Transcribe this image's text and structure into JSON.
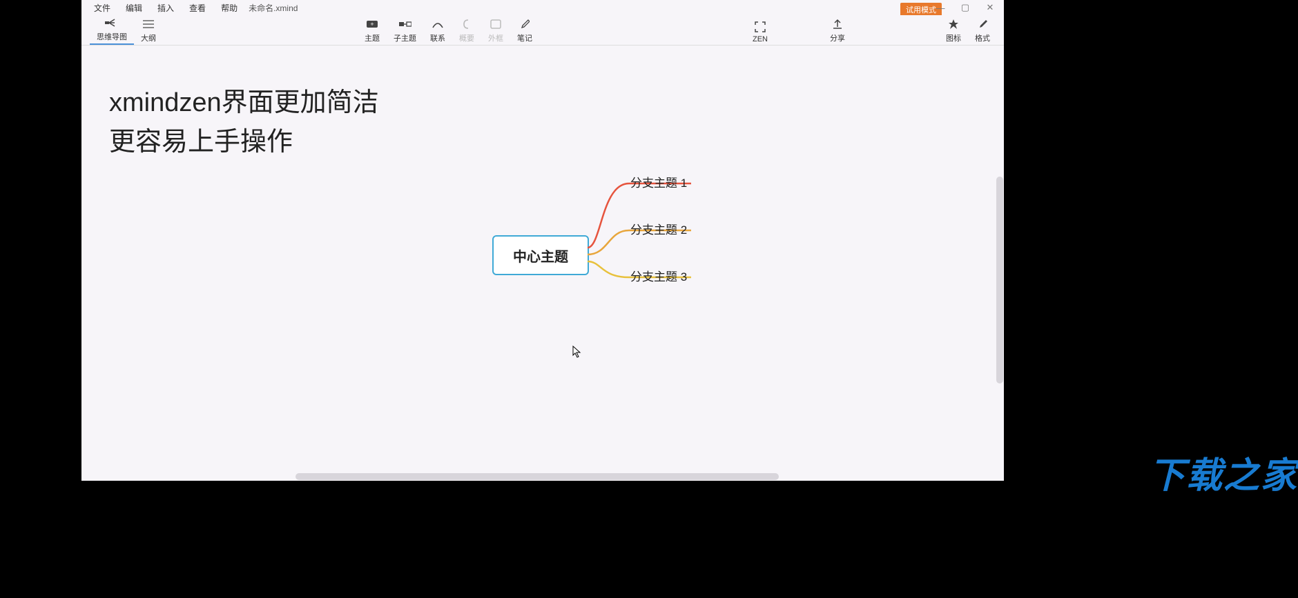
{
  "menubar": {
    "items": [
      "文件",
      "编辑",
      "插入",
      "查看",
      "帮助"
    ],
    "docname": "未命名.xmind"
  },
  "trial_label": "试用模式",
  "window_controls": {
    "min": "—",
    "max": "▢",
    "close": "✕"
  },
  "toolbar": {
    "left": [
      {
        "label": "思维导图",
        "active": true
      },
      {
        "label": "大纲",
        "active": false
      }
    ],
    "center": [
      {
        "label": "主题",
        "disabled": false
      },
      {
        "label": "子主题",
        "disabled": false
      },
      {
        "label": "联系",
        "disabled": false
      },
      {
        "label": "概要",
        "disabled": true
      },
      {
        "label": "外框",
        "disabled": true
      },
      {
        "label": "笔记",
        "disabled": false
      }
    ],
    "zen": "ZEN",
    "share": "分享",
    "right": [
      {
        "label": "图标"
      },
      {
        "label": "格式"
      }
    ]
  },
  "overlay": {
    "line1": "xmindzen界面更加简洁",
    "line2": "更容易上手操作"
  },
  "mindmap": {
    "central": "中心主题",
    "branches": [
      {
        "label": "分支主题 1",
        "color": "#e6543e"
      },
      {
        "label": "分支主题 2",
        "color": "#e8a63c"
      },
      {
        "label": "分支主题 3",
        "color": "#e8c13c"
      }
    ]
  },
  "watermark": "下载之家"
}
